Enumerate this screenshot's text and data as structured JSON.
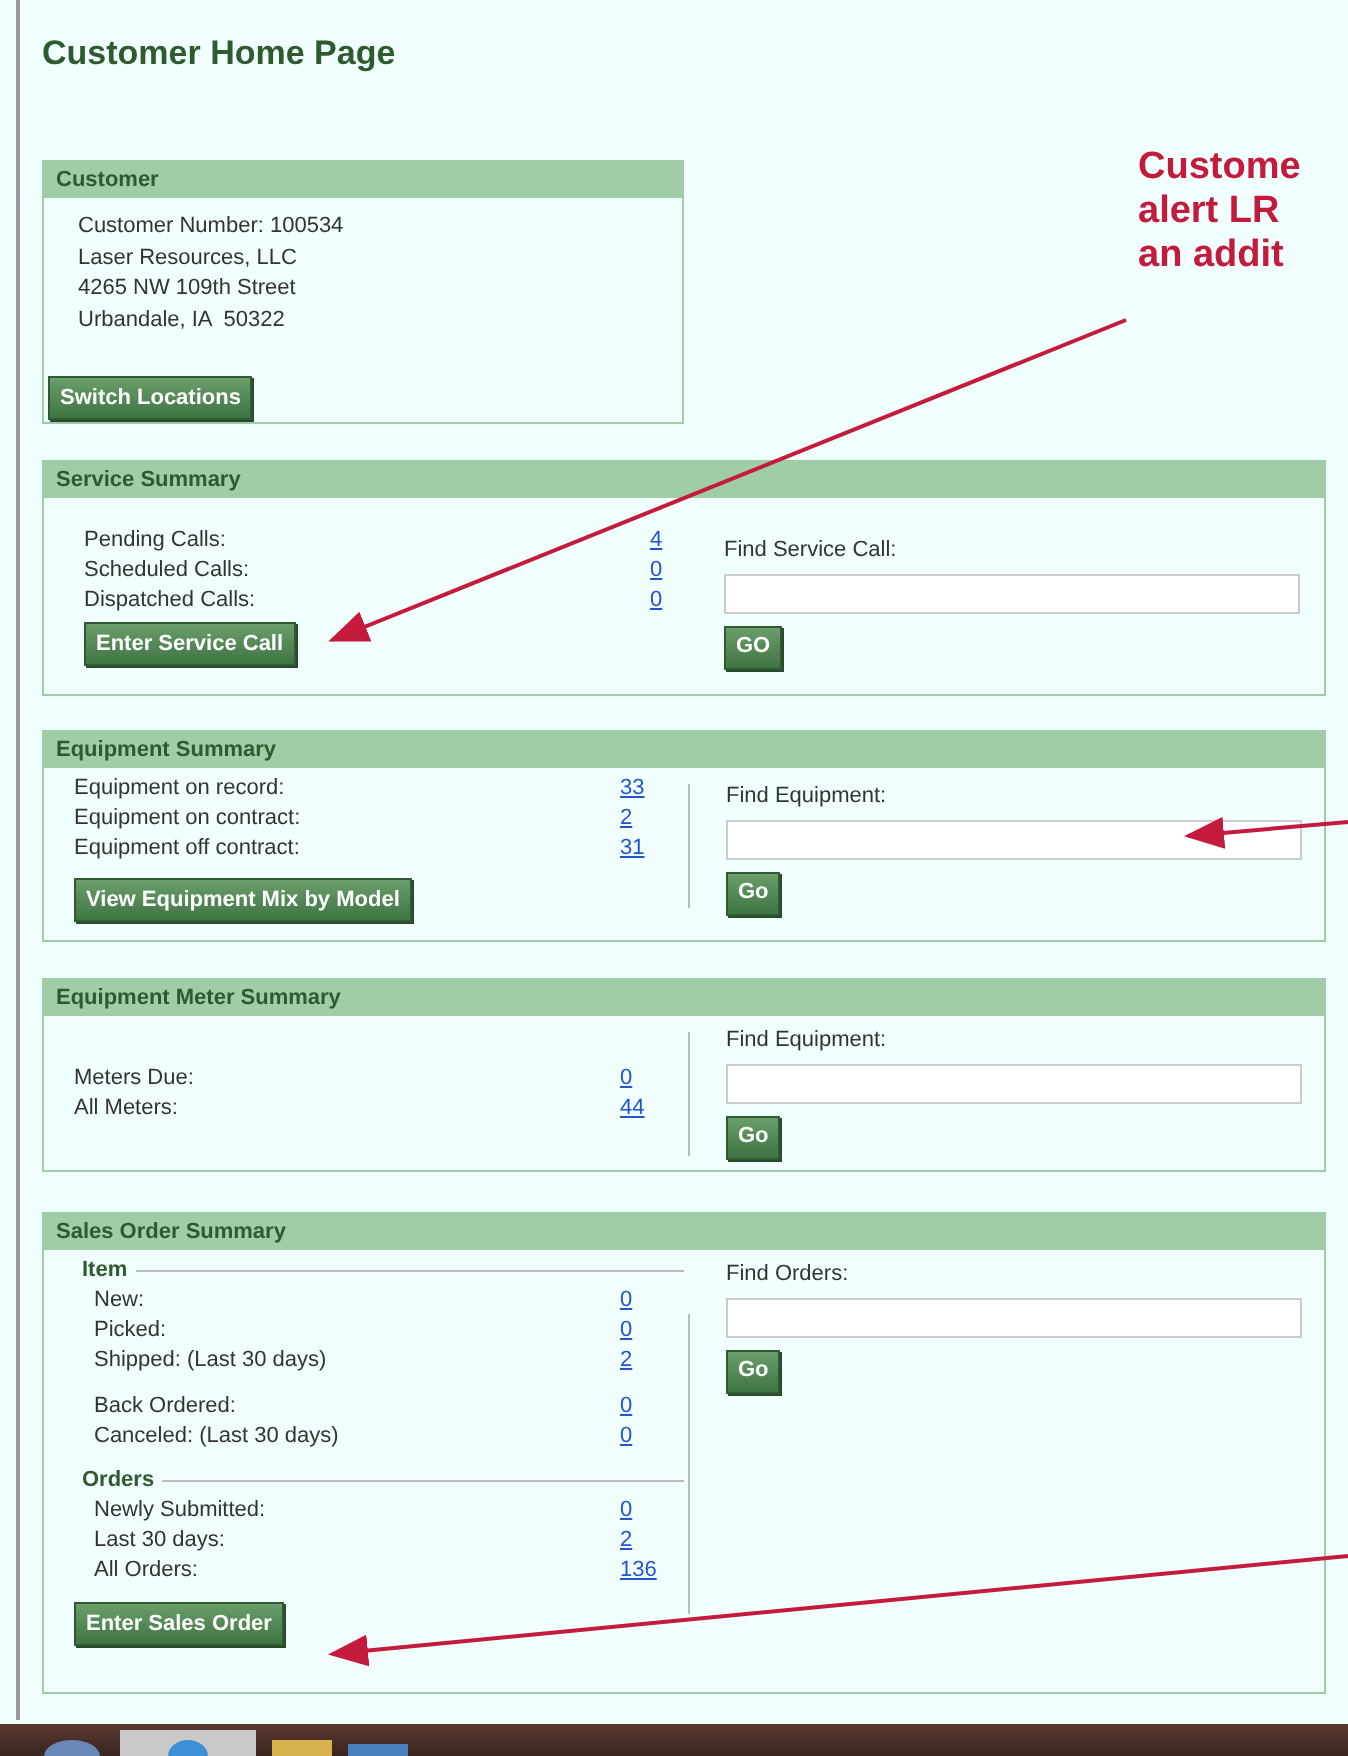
{
  "page_title": "Customer Home Page",
  "customer": {
    "title": "Customer",
    "lines": [
      "Customer Number: 100534",
      "Laser Resources, LLC",
      "4265 NW 109th Street",
      "Urbandale, IA  50322"
    ],
    "button": "Switch Locations"
  },
  "service_summary": {
    "title": "Service Summary",
    "stats": [
      {
        "label": "Pending Calls:",
        "value": "4"
      },
      {
        "label": "Scheduled Calls:",
        "value": "0"
      },
      {
        "label": "Dispatched Calls:",
        "value": "0"
      }
    ],
    "button": "Enter Service Call",
    "search": {
      "label": "Find Service Call:",
      "button": "GO"
    }
  },
  "equipment_summary": {
    "title": "Equipment Summary",
    "stats": [
      {
        "label": "Equipment on record:",
        "value": "33"
      },
      {
        "label": "Equipment on contract:",
        "value": "2"
      },
      {
        "label": "Equipment off contract:",
        "value": "31"
      }
    ],
    "button": "View Equipment Mix by Model",
    "search": {
      "label": "Find Equipment:",
      "button": "Go"
    }
  },
  "meter_summary": {
    "title": "Equipment Meter Summary",
    "stats": [
      {
        "label": "Meters Due:",
        "value": "0"
      },
      {
        "label": "All Meters:",
        "value": "44"
      }
    ],
    "search": {
      "label": "Find Equipment:",
      "button": "Go"
    }
  },
  "sales_order_summary": {
    "title": "Sales Order Summary",
    "groups": [
      {
        "heading": "Item",
        "blocks": [
          [
            {
              "label": "New:",
              "value": "0"
            },
            {
              "label": "Picked:",
              "value": "0"
            },
            {
              "label": "Shipped: (Last 30 days)",
              "value": "2"
            }
          ],
          [
            {
              "label": "Back Ordered:",
              "value": "0"
            },
            {
              "label": "Canceled: (Last 30 days)",
              "value": "0"
            }
          ]
        ]
      },
      {
        "heading": "Orders",
        "blocks": [
          [
            {
              "label": "Newly Submitted:",
              "value": "0"
            },
            {
              "label": "Last 30 days:",
              "value": "2"
            },
            {
              "label": "All Orders:",
              "value": "136"
            }
          ]
        ]
      }
    ],
    "button": "Enter Sales Order",
    "search": {
      "label": "Find Orders:",
      "button": "Go"
    }
  },
  "annotation": {
    "lines": [
      "Custome",
      "alert LR",
      "an addit"
    ]
  }
}
